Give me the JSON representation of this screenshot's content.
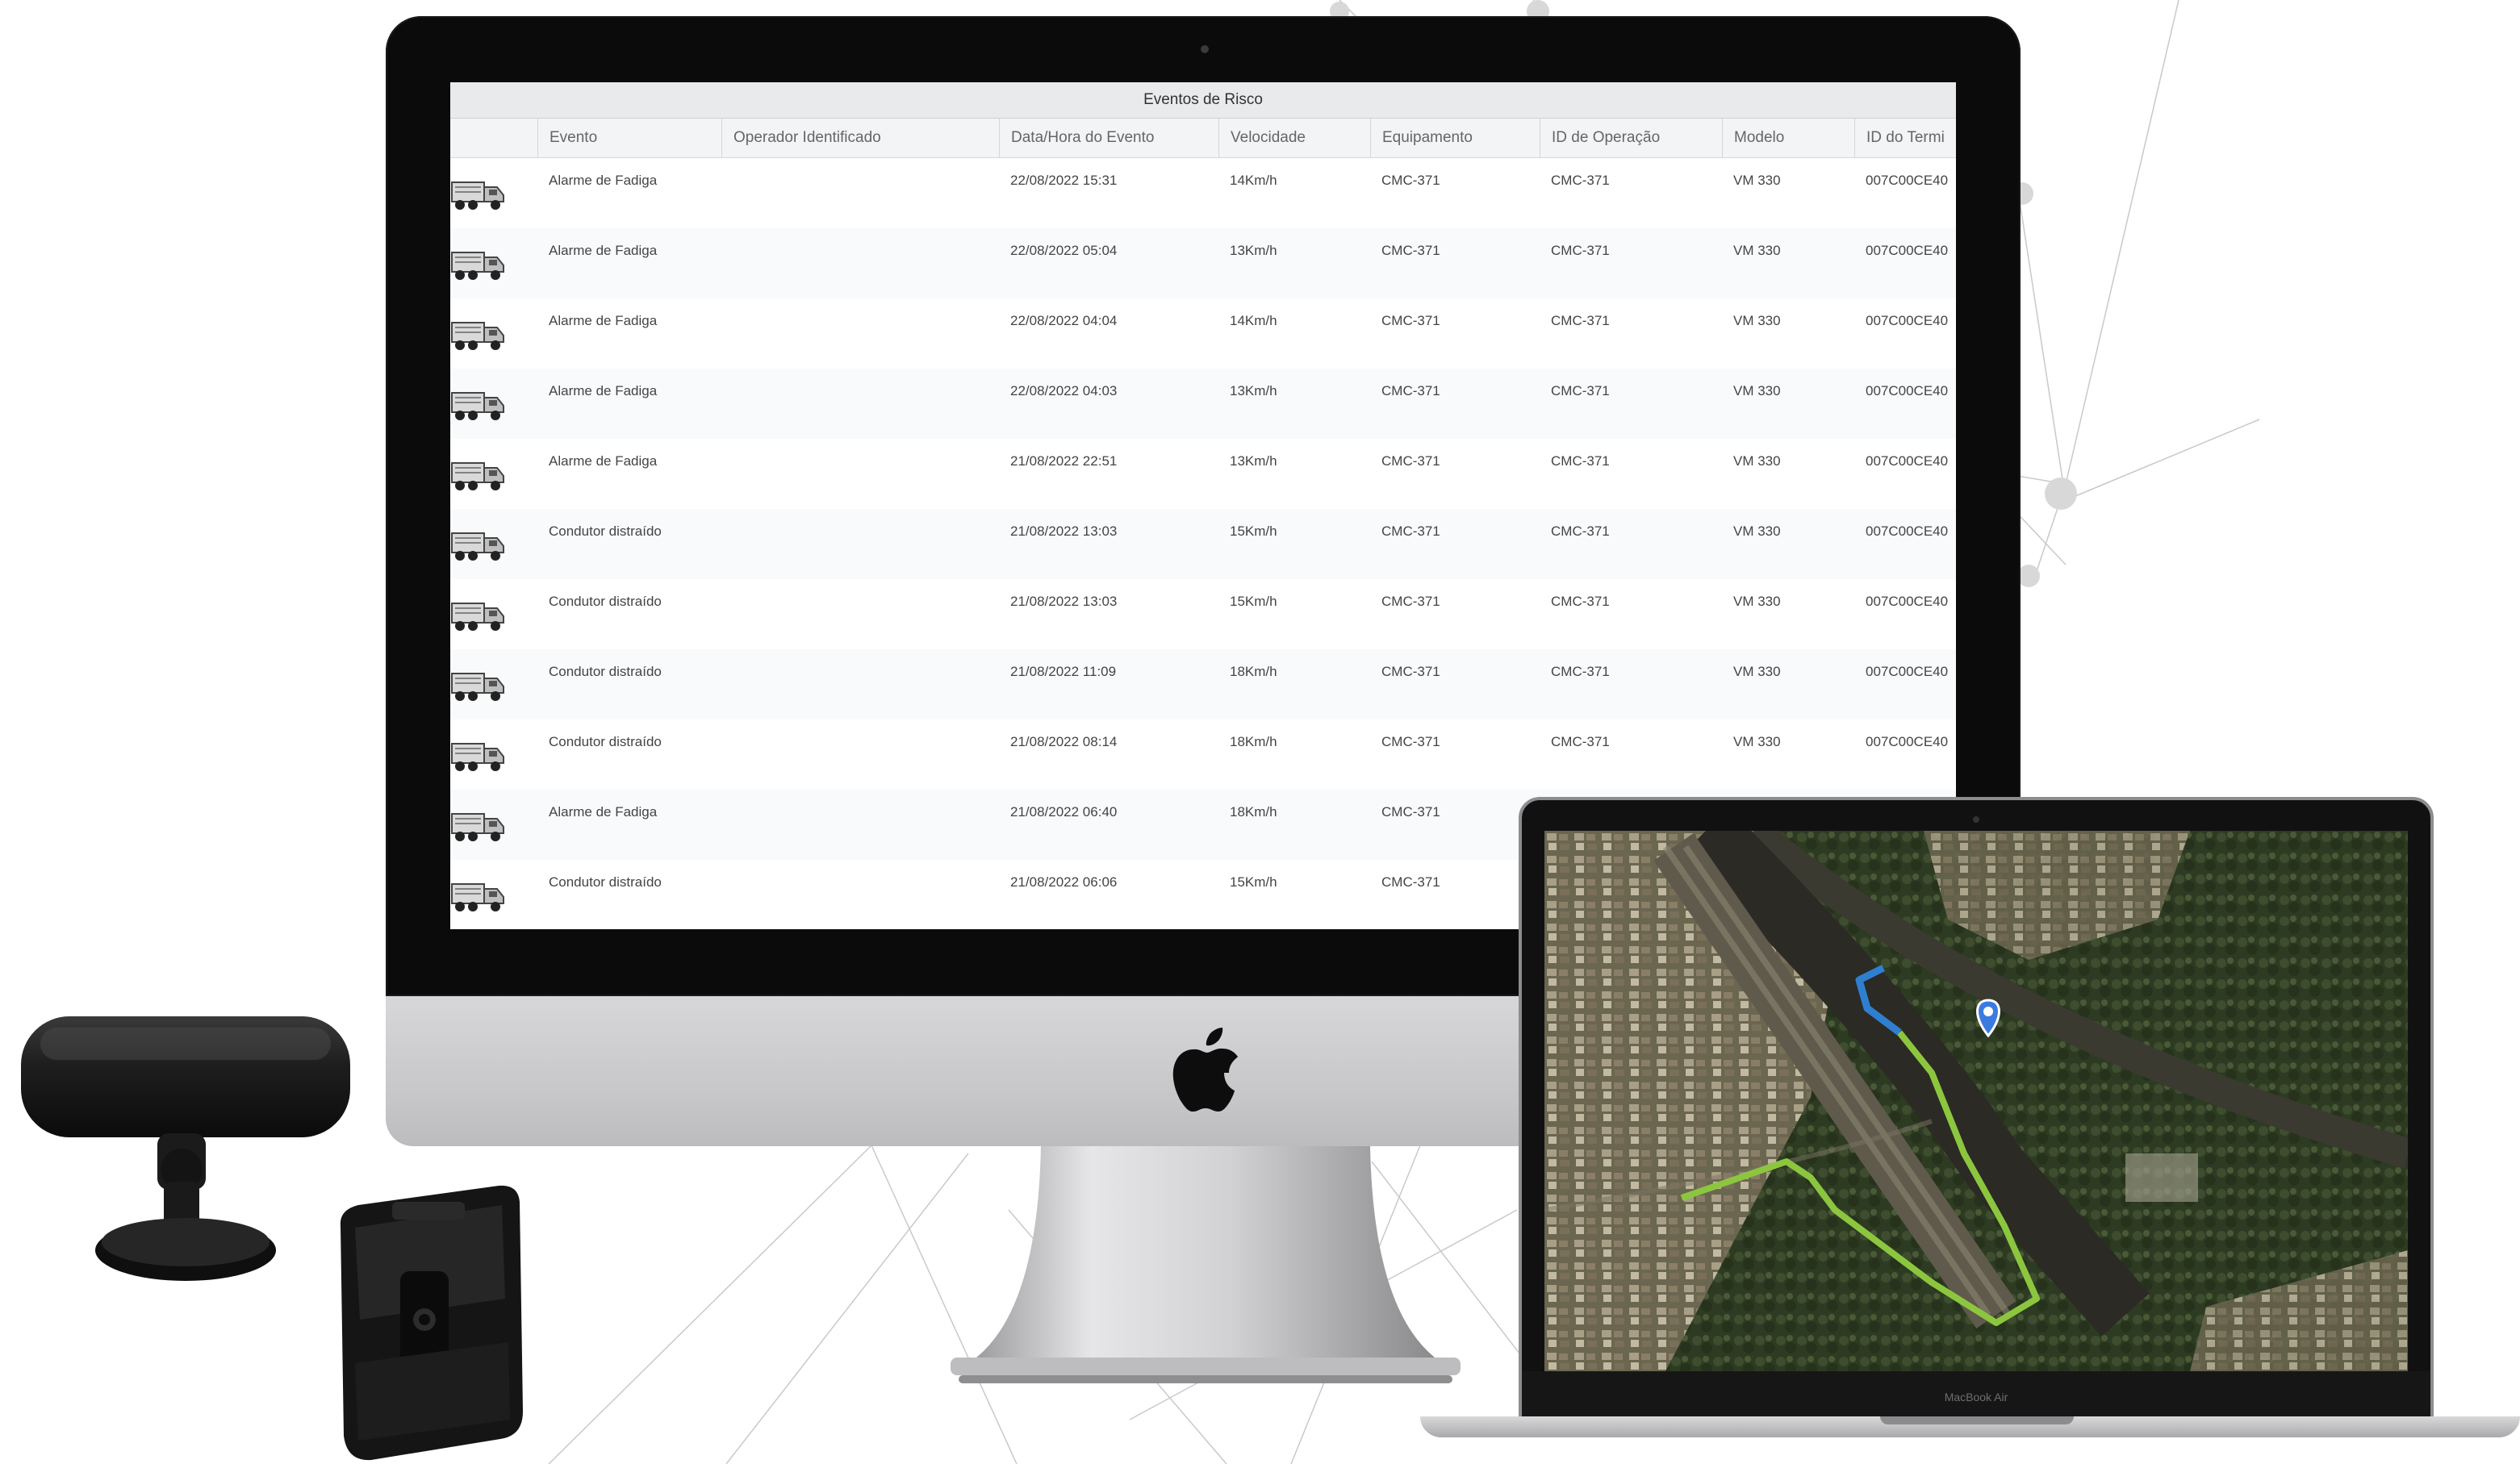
{
  "window": {
    "title": "Eventos de Risco"
  },
  "table": {
    "columns": [
      "Evento",
      "Operador Identificado",
      "Data/Hora do Evento",
      "Velocidade",
      "Equipamento",
      "ID de Operação",
      "Modelo",
      "ID do Termi"
    ],
    "rows": [
      {
        "evento": "Alarme de Fadiga",
        "operador": "",
        "datahora": "22/08/2022 15:31",
        "velocidade": "14Km/h",
        "equipamento": "CMC-371",
        "id_operacao": "CMC-371",
        "modelo": "VM 330",
        "id_terminal": "007C00CE40"
      },
      {
        "evento": "Alarme de Fadiga",
        "operador": "",
        "datahora": "22/08/2022 05:04",
        "velocidade": "13Km/h",
        "equipamento": "CMC-371",
        "id_operacao": "CMC-371",
        "modelo": "VM 330",
        "id_terminal": "007C00CE40"
      },
      {
        "evento": "Alarme de Fadiga",
        "operador": "",
        "datahora": "22/08/2022 04:04",
        "velocidade": "14Km/h",
        "equipamento": "CMC-371",
        "id_operacao": "CMC-371",
        "modelo": "VM 330",
        "id_terminal": "007C00CE40"
      },
      {
        "evento": "Alarme de Fadiga",
        "operador": "",
        "datahora": "22/08/2022 04:03",
        "velocidade": "13Km/h",
        "equipamento": "CMC-371",
        "id_operacao": "CMC-371",
        "modelo": "VM 330",
        "id_terminal": "007C00CE40"
      },
      {
        "evento": "Alarme de Fadiga",
        "operador": "",
        "datahora": "21/08/2022 22:51",
        "velocidade": "13Km/h",
        "equipamento": "CMC-371",
        "id_operacao": "CMC-371",
        "modelo": "VM 330",
        "id_terminal": "007C00CE40"
      },
      {
        "evento": "Condutor distraído",
        "operador": "",
        "datahora": "21/08/2022 13:03",
        "velocidade": "15Km/h",
        "equipamento": "CMC-371",
        "id_operacao": "CMC-371",
        "modelo": "VM 330",
        "id_terminal": "007C00CE40"
      },
      {
        "evento": "Condutor distraído",
        "operador": "",
        "datahora": "21/08/2022 13:03",
        "velocidade": "15Km/h",
        "equipamento": "CMC-371",
        "id_operacao": "CMC-371",
        "modelo": "VM 330",
        "id_terminal": "007C00CE40"
      },
      {
        "evento": "Condutor distraído",
        "operador": "",
        "datahora": "21/08/2022 11:09",
        "velocidade": "18Km/h",
        "equipamento": "CMC-371",
        "id_operacao": "CMC-371",
        "modelo": "VM 330",
        "id_terminal": "007C00CE40"
      },
      {
        "evento": "Condutor distraído",
        "operador": "",
        "datahora": "21/08/2022 08:14",
        "velocidade": "18Km/h",
        "equipamento": "CMC-371",
        "id_operacao": "CMC-371",
        "modelo": "VM 330",
        "id_terminal": "007C00CE40"
      },
      {
        "evento": "Alarme de Fadiga",
        "operador": "",
        "datahora": "21/08/2022 06:40",
        "velocidade": "18Km/h",
        "equipamento": "CMC-371",
        "id_operacao": "",
        "modelo": "",
        "id_terminal": ""
      },
      {
        "evento": "Condutor distraído",
        "operador": "",
        "datahora": "21/08/2022 06:06",
        "velocidade": "15Km/h",
        "equipamento": "CMC-371",
        "id_operacao": "",
        "modelo": "",
        "id_terminal": ""
      }
    ]
  },
  "laptop": {
    "model_label": "MacBook Air"
  },
  "colors": {
    "route_traveled": "#8cc63f",
    "route_recent": "#2f7fd1",
    "location_pin": "#3b7be0"
  },
  "icons": {
    "row_icon": "truck-icon",
    "brand_icon": "apple-logo-icon",
    "map_marker": "location-pin-icon"
  }
}
